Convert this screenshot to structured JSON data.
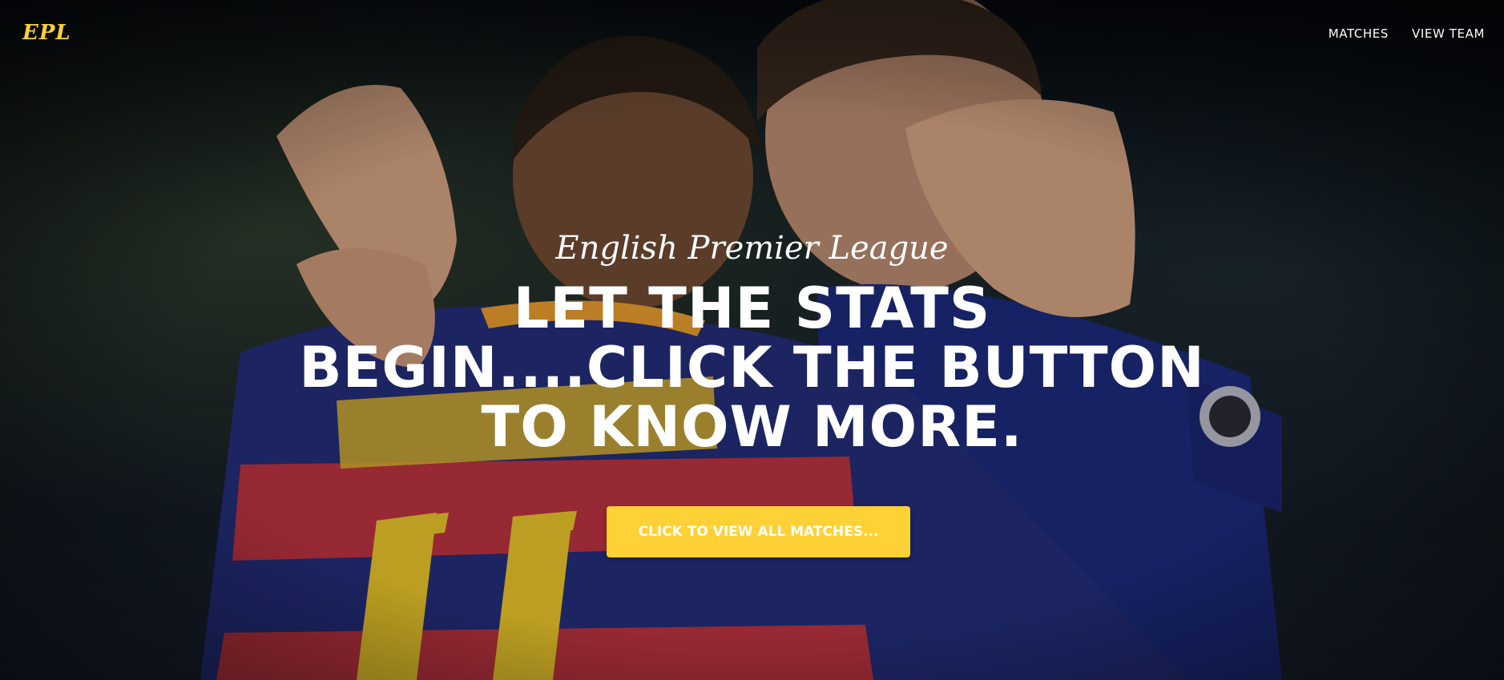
{
  "navbar": {
    "brand": "EPL",
    "links": [
      {
        "label": "MATCHES"
      },
      {
        "label": "VIEW TEAM"
      }
    ]
  },
  "intro": {
    "lead_in": "English Premier League",
    "heading": "LET THE STATS BEGIN....CLICK THE BUTTON TO KNOW MORE.",
    "cta_label": "CLICK TO VIEW ALL MATCHES..."
  },
  "colors": {
    "accent": "#fed136",
    "text": "#ffffff"
  }
}
